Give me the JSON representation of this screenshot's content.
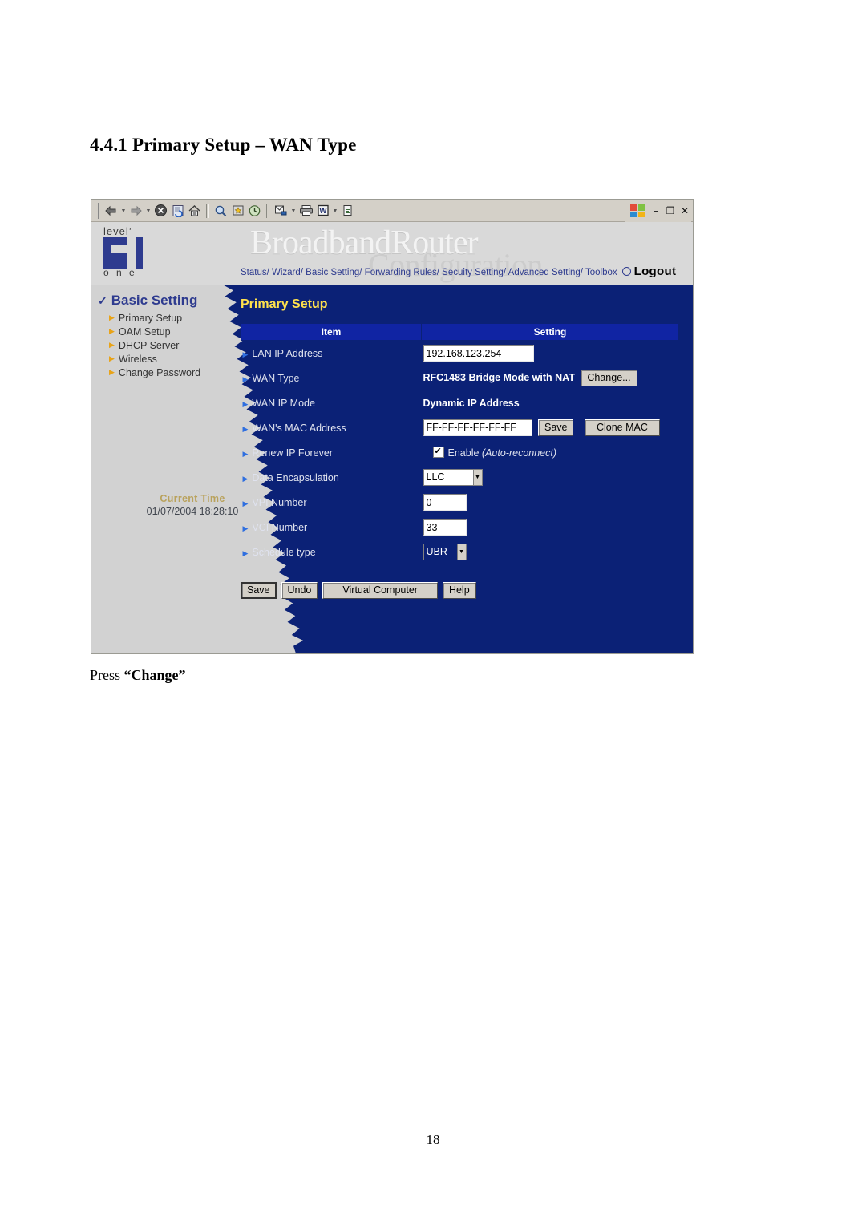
{
  "document": {
    "heading": "4.4.1 Primary Setup – WAN Type",
    "caption_prefix": "Press ",
    "caption_bold": "“Change”",
    "page_number": "18"
  },
  "browser": {
    "toolbar": {
      "back_icon": "back-arrow-icon",
      "forward_icon": "forward-arrow-icon",
      "stop_icon": "stop-icon",
      "refresh_icon": "refresh-icon",
      "home_icon": "home-icon",
      "search_icon": "search-icon",
      "favorites_icon": "favorites-icon",
      "history_icon": "history-icon",
      "mail_icon": "mail-icon",
      "print_icon": "print-icon",
      "edit_icon": "edit-word-icon",
      "edit_label": "W",
      "discuss_icon": "discuss-icon"
    },
    "window_controls": {
      "minimize": "–",
      "restore": "❐",
      "close": "✕"
    }
  },
  "router": {
    "brand": {
      "top": "level’",
      "bottom": "o n e"
    },
    "watermark_title": "BroadbandRouter",
    "watermark_sub": "Configuration",
    "nav": "Status/ Wizard/ Basic Setting/ Forwarding Rules/ Secuity Setting/ Advanced Setting/ Toolbox",
    "logout_label": "Logout",
    "sidebar": {
      "header": "Basic Setting",
      "items": [
        {
          "label": "Primary Setup"
        },
        {
          "label": "OAM Setup"
        },
        {
          "label": "DHCP Server"
        },
        {
          "label": "Wireless"
        },
        {
          "label": "Change Password"
        }
      ],
      "current_time_label": "Current Time",
      "current_time_value": "01/07/2004 18:28:10"
    },
    "panel": {
      "title": "Primary Setup",
      "columns": {
        "item": "Item",
        "setting": "Setting"
      },
      "rows": {
        "lan_ip": {
          "label": "LAN IP Address",
          "value": "192.168.123.254"
        },
        "wan_type": {
          "label": "WAN Type",
          "value": "RFC1483 Bridge Mode with NAT",
          "button": "Change..."
        },
        "wan_ip_mode": {
          "label": "WAN IP Mode",
          "value": "Dynamic IP Address"
        },
        "wan_mac": {
          "label": "WAN's MAC Address",
          "value": "FF-FF-FF-FF-FF-FF",
          "save_button": "Save",
          "clone_button": "Clone MAC"
        },
        "renew_ip": {
          "label": "Renew IP Forever",
          "checkbox_label": "Enable",
          "note": "(Auto-reconnect)",
          "checked": true
        },
        "data_encap": {
          "label": "Data Encapsulation",
          "value": "LLC"
        },
        "vpi": {
          "label": "VPI Number",
          "value": "0"
        },
        "vci": {
          "label": "VCI Number",
          "value": "33"
        },
        "schedule": {
          "label": "Schedule type",
          "value": "UBR"
        }
      },
      "buttons": {
        "save": "Save",
        "undo": "Undo",
        "virtual_computer": "Virtual Computer",
        "help": "Help"
      }
    },
    "colors": {
      "navy": "#0b2176",
      "header_blue": "#1024a3",
      "title_yellow": "#ffe14d",
      "brand_blue": "#2e3b8f",
      "sidebar_grey": "#d2d2d2",
      "time_label": "#b9a25c"
    }
  }
}
